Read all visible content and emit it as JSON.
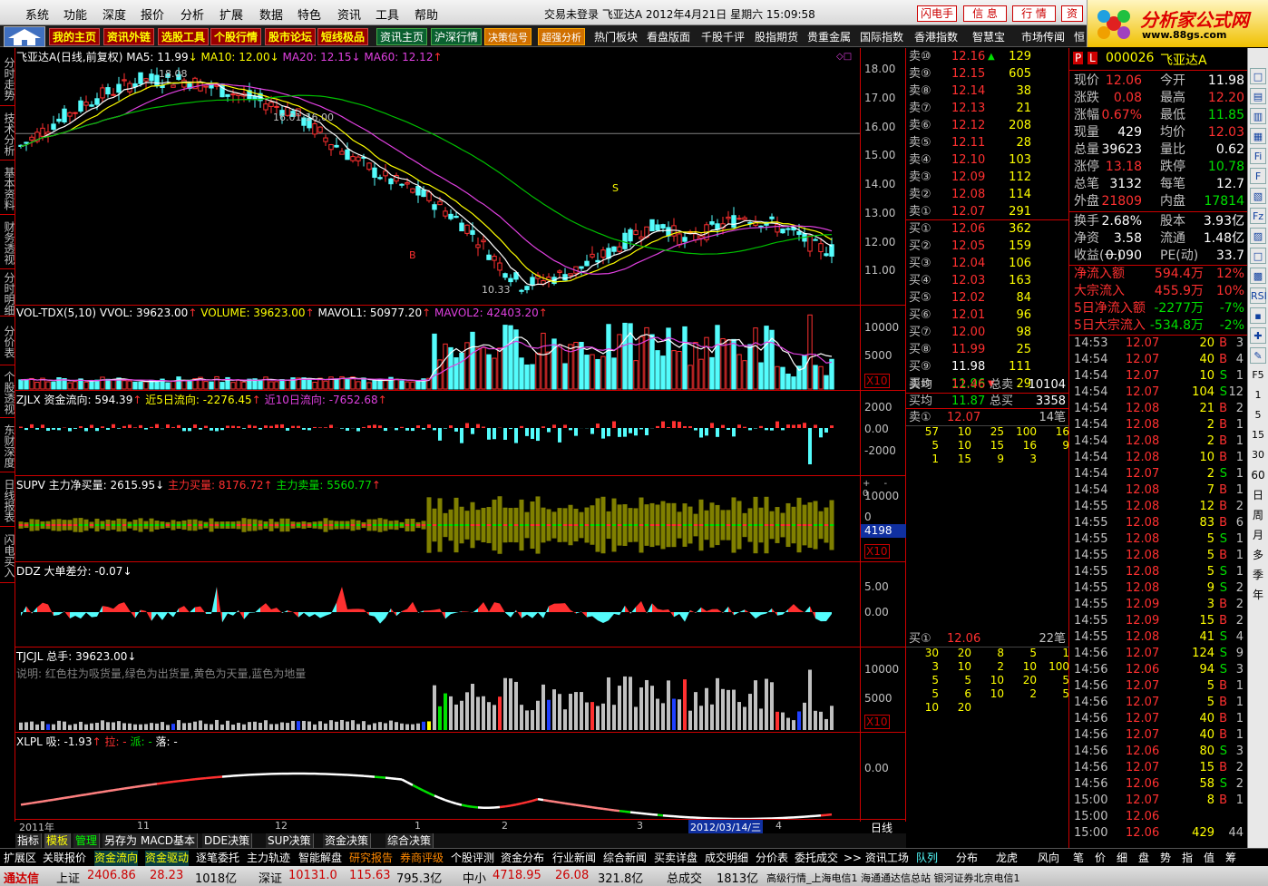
{
  "menu": [
    "系统",
    "功能",
    "深度",
    "报价",
    "分析",
    "扩展",
    "数据",
    "特色",
    "资讯",
    "工具",
    "帮助"
  ],
  "window_title": "交易未登录  飞亚达A  2012年4月21日 星期六 15:09:58",
  "top_buttons": [
    "闪电手",
    "信 息",
    "行 情",
    "资"
  ],
  "logo": {
    "line1": "分析家公式网",
    "line2": "www.88gs.com"
  },
  "nav_red": [
    "我的主页",
    "资讯外链",
    "选股工具",
    "个股行情",
    "股市论坛",
    "短线极品"
  ],
  "nav_green": [
    "资讯主页",
    "沪深行情"
  ],
  "nav_orange": [
    "决策信号",
    "超强分析"
  ],
  "nav_plain": [
    "热门板块",
    "看盘版面",
    "千股千评",
    "股指期货",
    "贵重金属",
    "国际指数",
    "香港指数",
    "智慧宝",
    "市场传闻",
    "恒"
  ],
  "left_tabs": [
    "分时走势",
    "技术分析",
    "基本资料",
    "财务透视",
    "分时明细",
    "分价表",
    "个股透视",
    "东财深度",
    "日线报表",
    "闪电买入"
  ],
  "panels": {
    "kline": {
      "title": "飞亚达A(日线,前复权)",
      "ma5": "MA5: 11.99",
      "ma10": "MA10: 12.00",
      "ma20": "MA20: 12.15",
      "ma60": "MA60: 12.12",
      "ann_high": "18.08",
      "ann_line": "16.01-16.00",
      "ann_low": "10.33",
      "sig_s": "S",
      "sig_b": "B",
      "ticks": [
        "18.00",
        "17.00",
        "16.00",
        "15.00",
        "14.00",
        "13.00",
        "12.00",
        "11.00"
      ]
    },
    "vol": {
      "title": "VOL-TDX(5,10)",
      "v1": "VVOL: 39623.00",
      "v2": "VOLUME: 39623.00",
      "v3": "MAVOL1: 50977.20",
      "v4": "MAVOL2: 42403.20",
      "ticks": [
        "10000",
        "5000"
      ],
      "unit": "X10"
    },
    "zjlx": {
      "title": "ZJLX 资金流向: 594.39",
      "v2": "近5日流向: -2276.45",
      "v3": "近10日流向: -7652.68",
      "ticks": [
        "2000",
        "0.00",
        "-2000"
      ]
    },
    "supv": {
      "title": "SUPV 主力净买量: 2615.95",
      "v2": "主力买量: 8176.72",
      "v3": "主力卖量: 5560.77",
      "ticks": [
        "10000",
        "0"
      ],
      "box": "4198",
      "unit": "X10"
    },
    "ddz": {
      "title": "DDZ 大单差分: -0.07",
      "ticks": [
        "5.00",
        "0.00"
      ]
    },
    "tjcjl": {
      "title": "TJCJL 总手: 39623.00",
      "desc": "说明: 红色柱为吸货量,绿色为出货量,黄色为天量,蓝色为地量",
      "ticks": [
        "10000",
        "5000"
      ],
      "unit": "X10"
    },
    "xlpl": {
      "title": "XLPL 吸: -1.93",
      "v2": "拉: -",
      "v3": "派: -",
      "v4": "落: -",
      "ticks": [
        "0.00"
      ]
    }
  },
  "xaxis": {
    "labels": [
      "2011年",
      "11",
      "12",
      "1",
      "2",
      "3",
      "2012/03/14/三",
      "4"
    ],
    "right": "日线"
  },
  "bottom_tabs": [
    "指标",
    "模板",
    "管理",
    "另存为",
    "MACD基本",
    "DDE决策",
    "SUP决策",
    "资金决策",
    "综合决策"
  ],
  "toolbar2": [
    "扩展区",
    "关联报价",
    "资金流向",
    "资金驱动",
    "逐笔委托",
    "主力轨迹",
    "智能解盘",
    "研究报告",
    "券商评级",
    "个股评测",
    "资金分布",
    "行业新闻",
    "综合新闻",
    "买卖详盘",
    "成交明细",
    "分价表",
    "委托成交",
    ">> 资讯工场"
  ],
  "toolbar2_right": [
    "队列",
    "分布",
    "龙虎",
    "风向"
  ],
  "toolbar2_far": [
    "笔",
    "价",
    "细",
    "盘",
    "势",
    "指",
    "值",
    "筹"
  ],
  "status": {
    "brand": "通达信",
    "sh_label": "上证",
    "sh": "2406.86",
    "sh_chg": "28.23",
    "sh_amt": "1018亿",
    "sz_label": "深证",
    "sz": "10131.0",
    "sz_chg": "115.63",
    "sz_amt": "795.3亿",
    "zx_label": "中小",
    "zx": "4718.95",
    "zx_chg": "26.08",
    "zx_amt": "321.8亿",
    "total_label": "总成交",
    "total": "1813亿",
    "server": "高级行情_上海电信1  海通通达信总站  银河证券北京电信1"
  },
  "orderbook": {
    "sell": [
      [
        "卖⑩",
        "12.16",
        "▲",
        "129"
      ],
      [
        "卖⑨",
        "12.15",
        "",
        "605"
      ],
      [
        "卖⑧",
        "12.14",
        "",
        "38"
      ],
      [
        "卖⑦",
        "12.13",
        "",
        "21"
      ],
      [
        "卖⑥",
        "12.12",
        "",
        "208"
      ],
      [
        "卖⑤",
        "12.11",
        "",
        "28"
      ],
      [
        "卖④",
        "12.10",
        "",
        "103"
      ],
      [
        "卖③",
        "12.09",
        "",
        "112"
      ],
      [
        "卖②",
        "12.08",
        "",
        "114"
      ],
      [
        "卖①",
        "12.07",
        "",
        "291"
      ]
    ],
    "buy": [
      [
        "买①",
        "12.06",
        "",
        "362"
      ],
      [
        "买②",
        "12.05",
        "",
        "159"
      ],
      [
        "买③",
        "12.04",
        "",
        "106"
      ],
      [
        "买④",
        "12.03",
        "",
        "163"
      ],
      [
        "买⑤",
        "12.02",
        "",
        "84"
      ],
      [
        "买⑥",
        "12.01",
        "",
        "96"
      ],
      [
        "买⑦",
        "12.00",
        "",
        "98"
      ],
      [
        "买⑧",
        "11.99",
        "",
        "25"
      ],
      [
        "买⑨",
        "11.98",
        "",
        "111"
      ],
      [
        "买⑩",
        "11.96",
        "▼",
        "29"
      ]
    ],
    "avg": [
      [
        "卖均",
        "12.46",
        "总卖",
        "10104"
      ],
      [
        "买均",
        "11.87",
        "总买",
        "3358"
      ]
    ],
    "queue_sell_head": [
      "卖①",
      "12.07",
      "14笔"
    ],
    "queue_sell": [
      [
        "57",
        "10",
        "25",
        "100",
        "16"
      ],
      [
        "5",
        "10",
        "15",
        "16",
        "9"
      ],
      [
        "1",
        "15",
        "9",
        "3",
        ""
      ]
    ],
    "queue_buy_head": [
      "买①",
      "12.06",
      "22笔"
    ],
    "queue_buy": [
      [
        "30",
        "20",
        "8",
        "5",
        "1"
      ],
      [
        "3",
        "10",
        "2",
        "10",
        "100"
      ],
      [
        "5",
        "5",
        "10",
        "20",
        "5"
      ],
      [
        "5",
        "6",
        "10",
        "2",
        "5"
      ],
      [
        "10",
        "20",
        "",
        "",
        ""
      ]
    ]
  },
  "info": {
    "code": "000026",
    "name": "飞亚达A",
    "pl": [
      "P",
      "L"
    ],
    "rows": [
      [
        "现价",
        "12.06",
        "今开",
        "11.98"
      ],
      [
        "涨跌",
        "0.08",
        "最高",
        "12.20"
      ],
      [
        "涨幅",
        "0.67%",
        "最低",
        "11.85"
      ],
      [
        "现量",
        "429",
        "均价",
        "12.03"
      ],
      [
        "总量",
        "39623",
        "量比",
        "0.62"
      ],
      [
        "涨停",
        "13.18",
        "跌停",
        "10.78"
      ],
      [
        "总笔",
        "3132",
        "每笔",
        "12.7"
      ],
      [
        "外盘",
        "21809",
        "内盘",
        "17814"
      ]
    ],
    "rows2": [
      [
        "换手",
        "2.68%",
        "股本",
        "3.93亿"
      ],
      [
        "净资",
        "3.58",
        "流通",
        "1.48亿"
      ],
      [
        "收益(一)",
        "0.090",
        "PE(动)",
        "33.7"
      ]
    ],
    "flows": [
      [
        "净流入额",
        "594.4万",
        "12%"
      ],
      [
        "大宗流入",
        "455.9万",
        "10%"
      ],
      [
        "5日净流入额",
        "-2277万",
        "-7%"
      ],
      [
        "5日大宗流入",
        "-534.8万",
        "-2%"
      ]
    ],
    "ticks": [
      [
        "14:53",
        "12.07",
        "20",
        "B",
        "3"
      ],
      [
        "14:54",
        "12.07",
        "40",
        "B",
        "4"
      ],
      [
        "14:54",
        "12.07",
        "10",
        "S",
        "1"
      ],
      [
        "14:54",
        "12.07",
        "104",
        "S",
        "12"
      ],
      [
        "14:54",
        "12.08",
        "21",
        "B",
        "2"
      ],
      [
        "14:54",
        "12.08",
        "2",
        "B",
        "1"
      ],
      [
        "14:54",
        "12.08",
        "2",
        "B",
        "1"
      ],
      [
        "14:54",
        "12.08",
        "10",
        "B",
        "1"
      ],
      [
        "14:54",
        "12.07",
        "2",
        "S",
        "1"
      ],
      [
        "14:54",
        "12.08",
        "7",
        "B",
        "1"
      ],
      [
        "14:55",
        "12.08",
        "12",
        "B",
        "2"
      ],
      [
        "14:55",
        "12.08",
        "83",
        "B",
        "6"
      ],
      [
        "14:55",
        "12.08",
        "5",
        "S",
        "1"
      ],
      [
        "14:55",
        "12.08",
        "5",
        "B",
        "1"
      ],
      [
        "14:55",
        "12.08",
        "5",
        "S",
        "1"
      ],
      [
        "14:55",
        "12.08",
        "9",
        "S",
        "2"
      ],
      [
        "14:55",
        "12.09",
        "3",
        "B",
        "2"
      ],
      [
        "14:55",
        "12.09",
        "15",
        "B",
        "2"
      ],
      [
        "14:55",
        "12.08",
        "41",
        "S",
        "4"
      ],
      [
        "14:56",
        "12.07",
        "124",
        "S",
        "9"
      ],
      [
        "14:56",
        "12.06",
        "94",
        "S",
        "3"
      ],
      [
        "14:56",
        "12.07",
        "5",
        "B",
        "1"
      ],
      [
        "14:56",
        "12.07",
        "5",
        "B",
        "1"
      ],
      [
        "14:56",
        "12.07",
        "40",
        "B",
        "1"
      ],
      [
        "14:56",
        "12.07",
        "40",
        "B",
        "1"
      ],
      [
        "14:56",
        "12.06",
        "80",
        "S",
        "3"
      ],
      [
        "14:56",
        "12.07",
        "15",
        "B",
        "2"
      ],
      [
        "14:56",
        "12.06",
        "58",
        "S",
        "2"
      ],
      [
        "15:00",
        "12.07",
        "8",
        "B",
        "1"
      ],
      [
        "15:00",
        "12.06",
        "",
        "",
        " "
      ],
      [
        "15:00",
        "12.06",
        "429",
        "",
        "44"
      ]
    ]
  },
  "right_icons": [
    "□",
    "▤",
    "▥",
    "▦",
    "Fi",
    "F",
    "▧",
    "Fz",
    "▨",
    "□",
    "▩",
    "RSI",
    "▪",
    "✚",
    "✎",
    "F5",
    "1",
    "5",
    "15",
    "30",
    "60",
    "日",
    "周",
    "月",
    "多",
    "季",
    "年"
  ]
}
